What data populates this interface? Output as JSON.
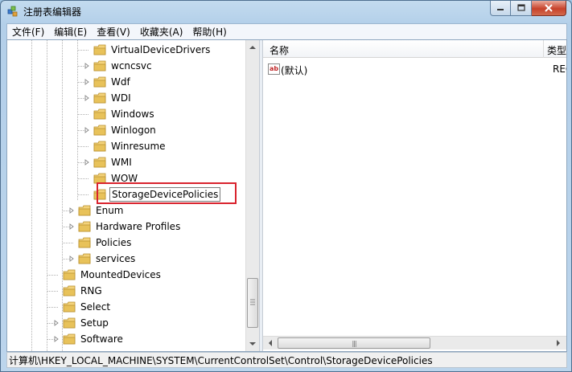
{
  "window": {
    "title": "注册表编辑器"
  },
  "menu": [
    "文件(F)",
    "编辑(E)",
    "查看(V)",
    "收藏夹(A)",
    "帮助(H)"
  ],
  "tree": [
    {
      "label": "VirtualDeviceDrivers",
      "level": 3,
      "expander": "none"
    },
    {
      "label": "wcncsvc",
      "level": 3,
      "expander": "collapsed"
    },
    {
      "label": "Wdf",
      "level": 3,
      "expander": "collapsed"
    },
    {
      "label": "WDI",
      "level": 3,
      "expander": "collapsed"
    },
    {
      "label": "Windows",
      "level": 3,
      "expander": "none"
    },
    {
      "label": "Winlogon",
      "level": 3,
      "expander": "collapsed"
    },
    {
      "label": "Winresume",
      "level": 3,
      "expander": "none"
    },
    {
      "label": "WMI",
      "level": 3,
      "expander": "collapsed"
    },
    {
      "label": "WOW",
      "level": 3,
      "expander": "none"
    },
    {
      "label": "StorageDevicePolicies",
      "level": 3,
      "expander": "none",
      "selected": true
    },
    {
      "label": "Enum",
      "level": 2,
      "expander": "collapsed"
    },
    {
      "label": "Hardware Profiles",
      "level": 2,
      "expander": "collapsed"
    },
    {
      "label": "Policies",
      "level": 2,
      "expander": "none"
    },
    {
      "label": "services",
      "level": 2,
      "expander": "collapsed"
    },
    {
      "label": "MountedDevices",
      "level": 1,
      "expander": "none"
    },
    {
      "label": "RNG",
      "level": 1,
      "expander": "none"
    },
    {
      "label": "Select",
      "level": 1,
      "expander": "none"
    },
    {
      "label": "Setup",
      "level": 1,
      "expander": "collapsed"
    },
    {
      "label": "Software",
      "level": 1,
      "expander": "collapsed"
    }
  ],
  "list": {
    "columns": [
      "名称",
      "类型"
    ],
    "rows": [
      {
        "name": "(默认)",
        "type": "REG",
        "icon": "reg-string-icon"
      }
    ]
  },
  "hscroll_thumb_grip": "|||",
  "status": {
    "path": "计算机\\HKEY_LOCAL_MACHINE\\SYSTEM\\CurrentControlSet\\Control\\StorageDevicePolicies"
  },
  "colors": {
    "highlight_box": "#d9232e",
    "folder": "#e8c25a"
  }
}
